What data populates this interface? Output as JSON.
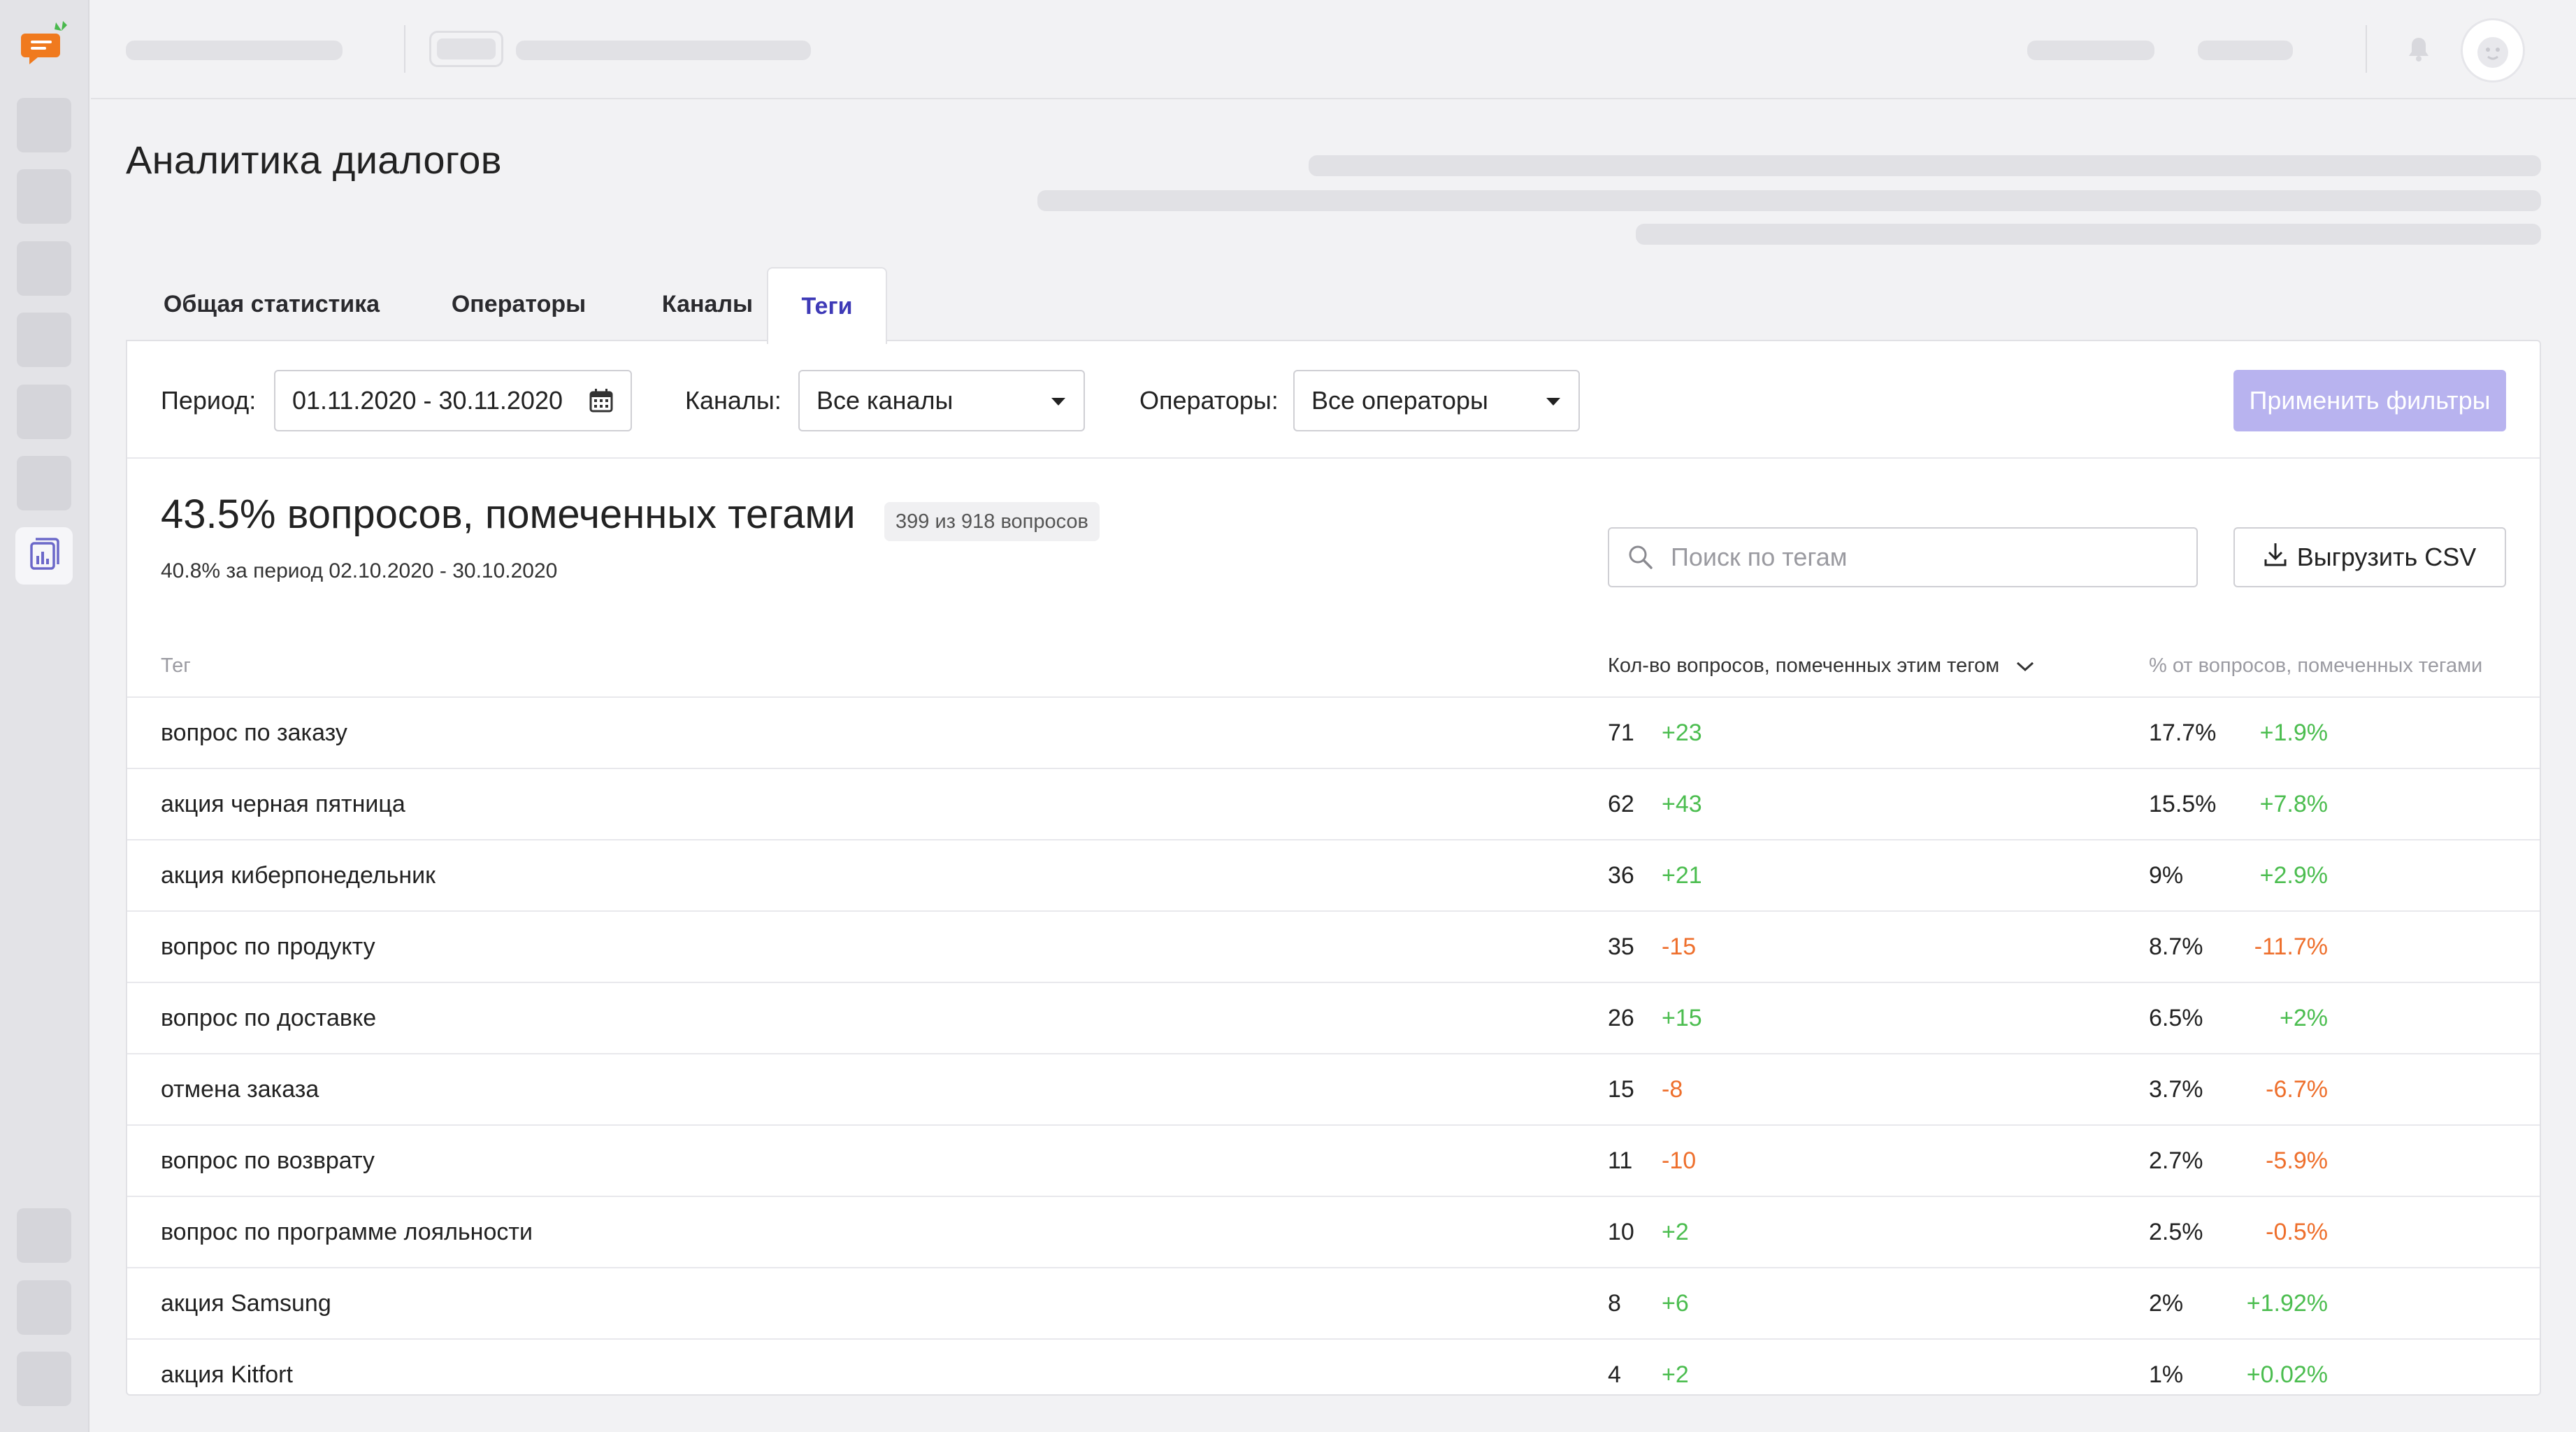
{
  "page": {
    "title": "Аналитика диалогов"
  },
  "tabs": [
    {
      "label": "Общая статистика",
      "active": false
    },
    {
      "label": "Операторы",
      "active": false
    },
    {
      "label": "Каналы",
      "active": false
    },
    {
      "label": "Теги",
      "active": true
    }
  ],
  "filters": {
    "period_label": "Период:",
    "period_value": "01.11.2020 - 30.11.2020",
    "channels_label": "Каналы:",
    "channels_value": "Все каналы",
    "operators_label": "Операторы:",
    "operators_value": "Все операторы",
    "apply_label": "Применить фильтры"
  },
  "summary": {
    "title": "43.5% вопросов, помеченных тегами",
    "badge": "399 из 918 вопросов",
    "subtitle": "40.8% за период 02.10.2020 - 30.10.2020"
  },
  "search": {
    "placeholder": "Поиск по тегам"
  },
  "export": {
    "label": "Выгрузить CSV"
  },
  "table": {
    "headers": {
      "tag": "Тег",
      "count": "Кол-во вопросов, помеченных этим тегом",
      "percent": "% от вопросов, помеченных тегами"
    },
    "rows": [
      {
        "tag": "вопрос по заказу",
        "count": "71",
        "count_delta": "+23",
        "percent": "17.7%",
        "percent_delta": "+1.9%"
      },
      {
        "tag": "акция черная пятница",
        "count": "62",
        "count_delta": "+43",
        "percent": "15.5%",
        "percent_delta": "+7.8%"
      },
      {
        "tag": "акция киберпонедельник",
        "count": "36",
        "count_delta": "+21",
        "percent": "9%",
        "percent_delta": "+2.9%"
      },
      {
        "tag": "вопрос по продукту",
        "count": "35",
        "count_delta": "-15",
        "percent": "8.7%",
        "percent_delta": "-11.7%"
      },
      {
        "tag": "вопрос по доставке",
        "count": "26",
        "count_delta": "+15",
        "percent": "6.5%",
        "percent_delta": "+2%"
      },
      {
        "tag": "отмена заказа",
        "count": "15",
        "count_delta": "-8",
        "percent": "3.7%",
        "percent_delta": "-6.7%"
      },
      {
        "tag": "вопрос по возврату",
        "count": "11",
        "count_delta": "-10",
        "percent": "2.7%",
        "percent_delta": "-5.9%"
      },
      {
        "tag": "вопрос по программе лояльности",
        "count": "10",
        "count_delta": "+2",
        "percent": "2.5%",
        "percent_delta": "-0.5%"
      },
      {
        "tag": "акция Samsung",
        "count": "8",
        "count_delta": "+6",
        "percent": "2%",
        "percent_delta": "+1.92%"
      },
      {
        "tag": "акция Kitfort",
        "count": "4",
        "count_delta": "+2",
        "percent": "1%",
        "percent_delta": "+0.02%"
      }
    ]
  },
  "colors": {
    "accent": "#3e3ab7",
    "apply_button": "#b8b3ef",
    "positive": "#4bbd4f",
    "negative": "#ee6f2c"
  },
  "icons": [
    "logo-icon",
    "analytics-icon",
    "calendar-icon",
    "search-icon",
    "download-icon",
    "bell-icon",
    "avatar-icon",
    "sort-chevron-icon"
  ]
}
